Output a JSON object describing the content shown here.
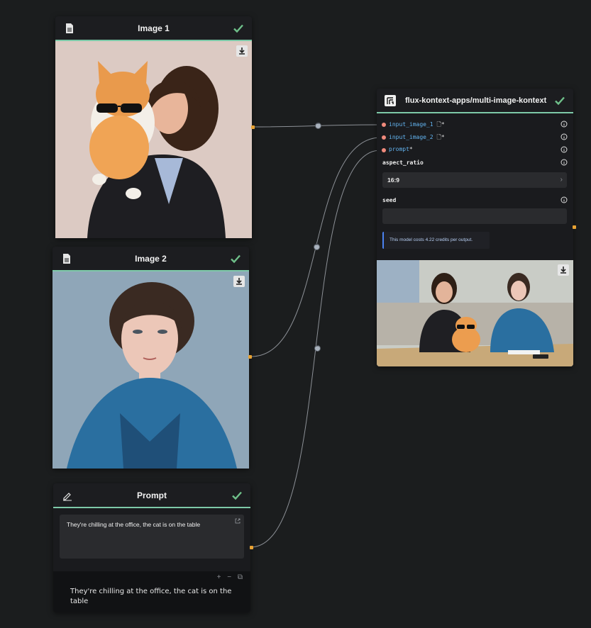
{
  "colors": {
    "accent": "#7dc9a8",
    "check": "#6fc08a",
    "port": "#e8a233",
    "wire": "#8c9096",
    "link_text": "#63b5f2",
    "dot": "#f08a7c"
  },
  "nodes": {
    "image1": {
      "title": "Image 1",
      "icon": "document-icon",
      "status_icon": "check-icon",
      "download_icon": "download-icon"
    },
    "image2": {
      "title": "Image 2",
      "icon": "document-icon",
      "status_icon": "check-icon",
      "download_icon": "download-icon"
    },
    "prompt": {
      "title": "Prompt",
      "icon": "pencil-icon",
      "status_icon": "check-icon",
      "input_value": "They're chilling at the office, the cat is on the table",
      "footer_controls": "+ − ⧉",
      "output_text": "They're chilling at the office, the cat is on the table"
    },
    "flux": {
      "title": "flux-kontext-apps/multi-image-kontext",
      "icon": "model-logo-icon",
      "status_icon": "check-icon",
      "inputs": [
        {
          "label": "input_image_1",
          "suffix": "🗋*"
        },
        {
          "label": "input_image_2",
          "suffix": "🗋*"
        },
        {
          "label": "prompt",
          "suffix": "*"
        }
      ],
      "aspect_ratio": {
        "label": "aspect_ratio",
        "value": "16:9"
      },
      "seed": {
        "label": "seed",
        "value": ""
      },
      "cost_note": "This model costs 4.22 credits per output."
    }
  }
}
